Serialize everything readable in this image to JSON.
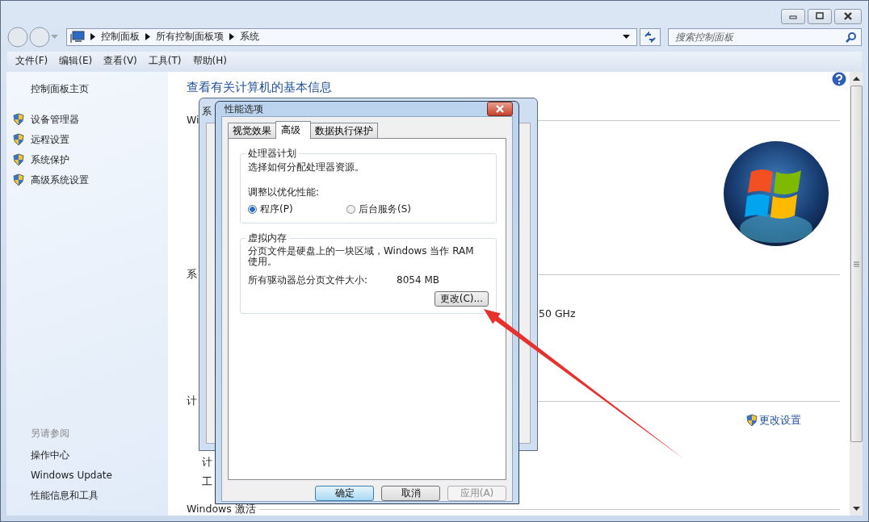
{
  "address_bar": {
    "breadcrumbs": [
      "控制面板",
      "所有控制面板项",
      "系统"
    ]
  },
  "search": {
    "placeholder": "搜索控制面板"
  },
  "menu": [
    "文件(F)",
    "编辑(E)",
    "查看(V)",
    "工具(T)",
    "帮助(H)"
  ],
  "sidebar": {
    "home": "控制面板主页",
    "items": [
      "设备管理器",
      "远程设置",
      "系统保护",
      "高级系统设置"
    ],
    "see_also_title": "另请参阅",
    "see_also": [
      "操作中心",
      "Windows Update",
      "性能信息和工具"
    ]
  },
  "content": {
    "heading": "查看有关计算机的基本信息",
    "section_1": "Wi",
    "section_2": "系",
    "processor_tail": "50 GHz",
    "section_3": "计",
    "change_settings": "更改设置",
    "row_1": "计",
    "row_2": "工",
    "activation": "Windows 激活"
  },
  "background_dialog": {
    "title": "系"
  },
  "dialog": {
    "title": "性能选项",
    "tabs": [
      {
        "label": "视觉效果",
        "selected": false
      },
      {
        "label": "高级",
        "selected": true
      },
      {
        "label": "数据执行保护",
        "selected": false
      }
    ],
    "processor": {
      "title": "处理器计划",
      "description": "选择如何分配处理器资源。",
      "prompt": "调整以优化性能:",
      "options": [
        {
          "label": "程序(P)",
          "selected": true
        },
        {
          "label": "后台服务(S)",
          "selected": false
        }
      ]
    },
    "memory": {
      "title": "虚拟内存",
      "description": "分页文件是硬盘上的一块区域，Windows 当作 RAM 使用。",
      "size_label": "所有驱动器总分页文件大小:",
      "size_value": "8054 MB",
      "button": "更改(C)..."
    },
    "buttons": [
      {
        "label": "确定",
        "default": true,
        "disabled": false
      },
      {
        "label": "取消",
        "default": false,
        "disabled": false
      },
      {
        "label": "应用(A)",
        "default": false,
        "disabled": true
      }
    ]
  }
}
